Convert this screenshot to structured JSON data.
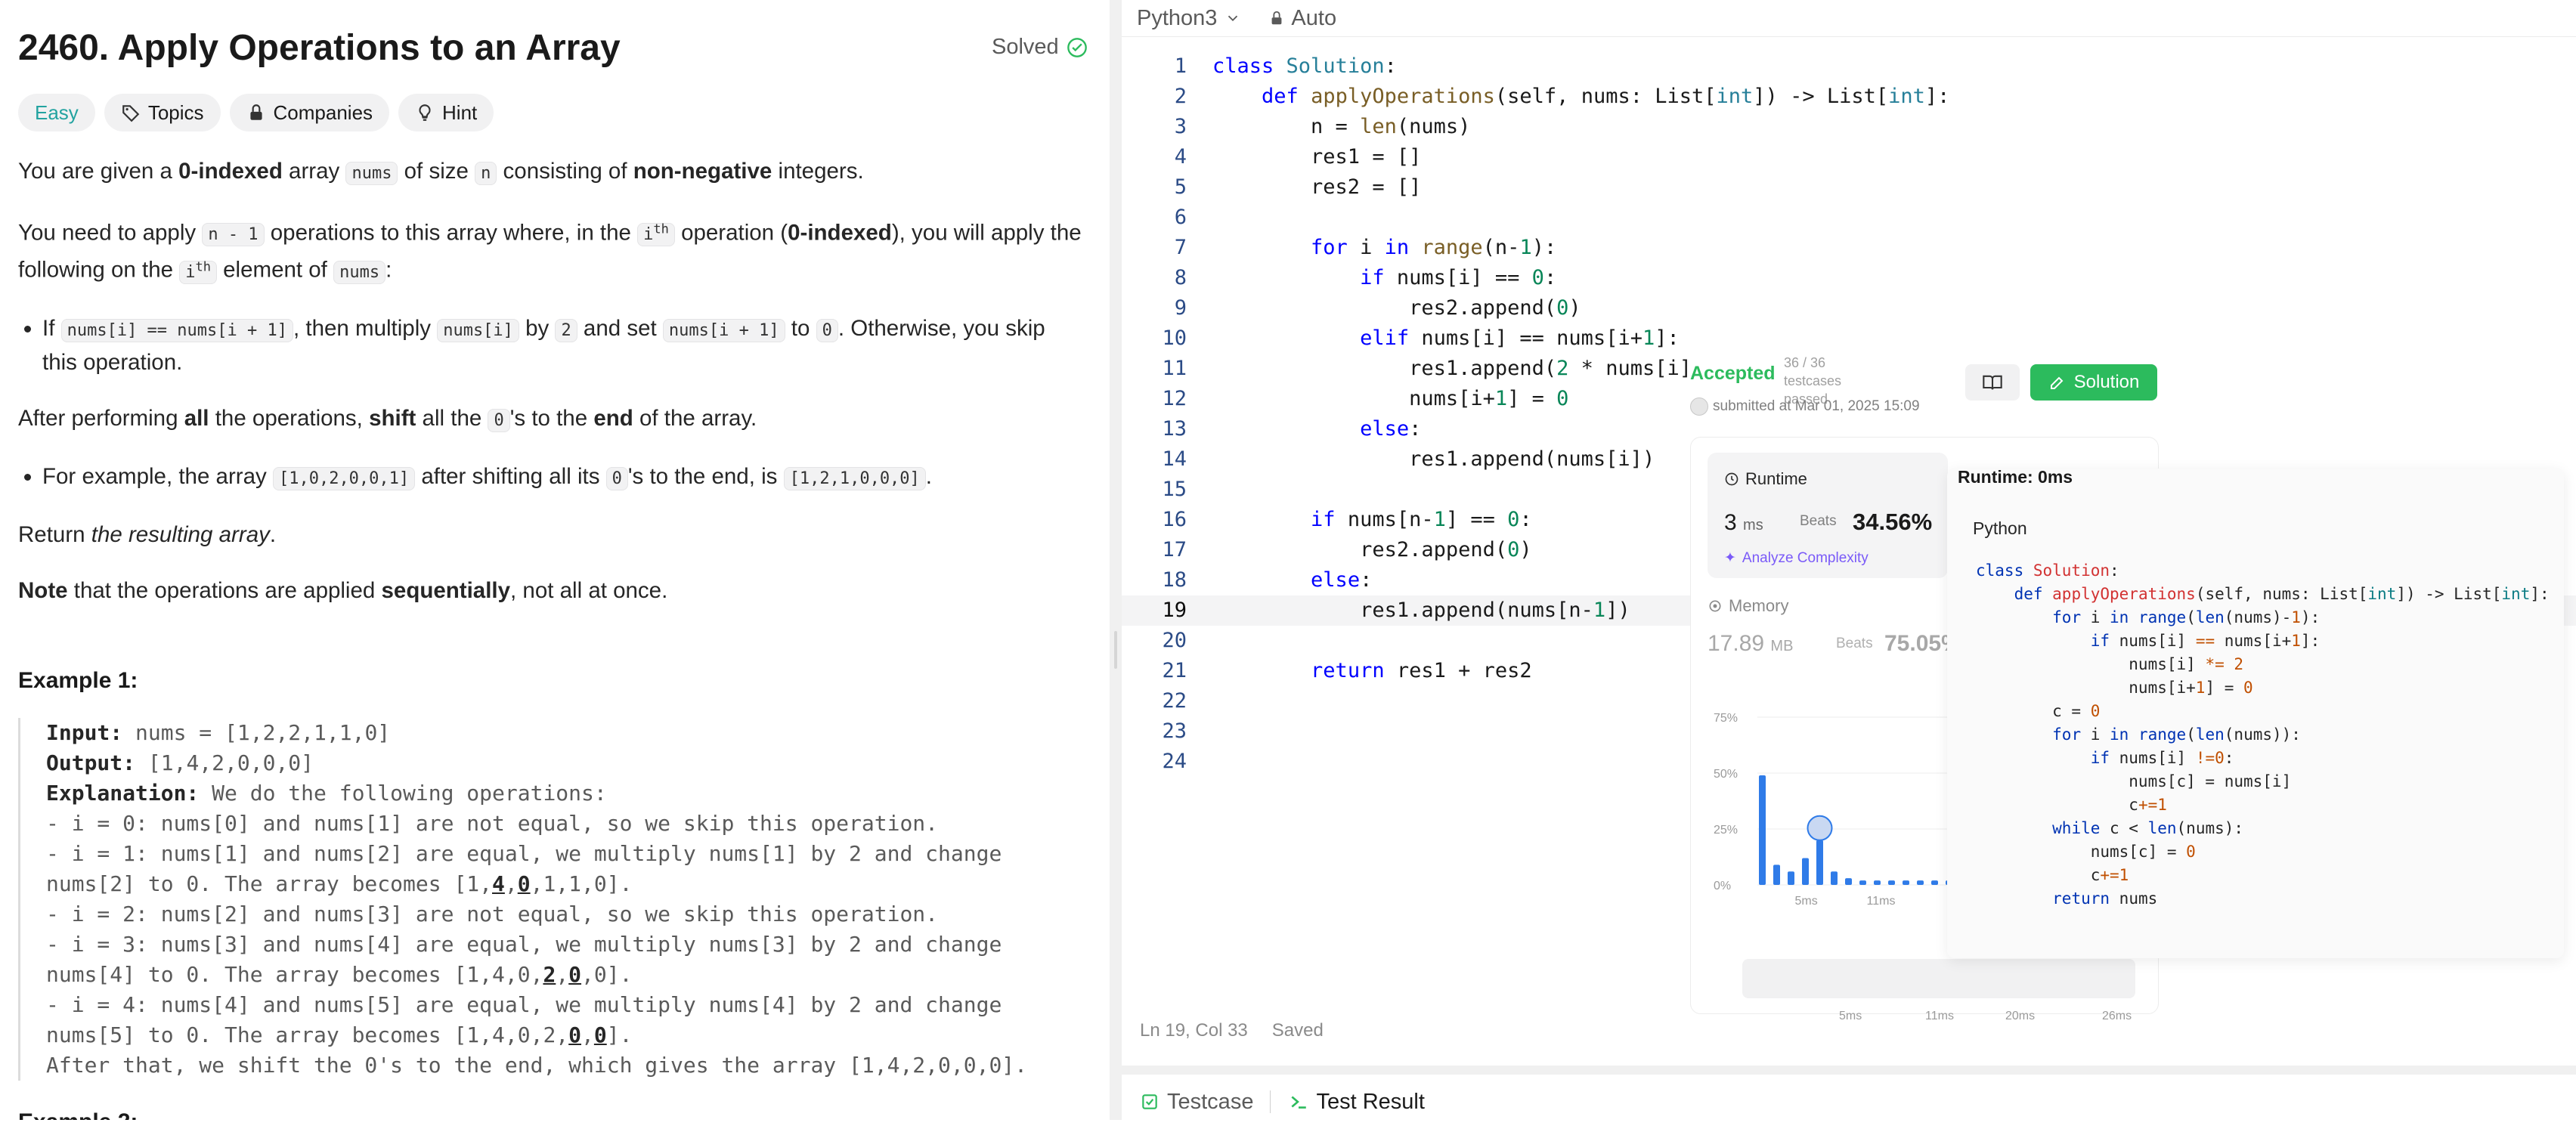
{
  "problem": {
    "title": "2460. Apply Operations to an Array",
    "status": "Solved",
    "tags": [
      "Easy",
      "Topics",
      "Companies",
      "Hint"
    ],
    "p1": {
      "t1": "You are given a ",
      "b1": "0-indexed",
      "t2": " array ",
      "c1": "nums",
      "t3": " of size ",
      "c2": "n",
      "t4": " consisting of ",
      "b2": "non-negative",
      "t5": " integers."
    },
    "p2": {
      "t1": "You need to apply ",
      "c1": "n - 1",
      "t2": " operations to this array where, in the ",
      "c2": "i",
      "s2": "th",
      "t3": " operation (",
      "b1": "0-indexed",
      "t4": "), you will apply the following on the ",
      "c3": "i",
      "s3": "th",
      "t5": " element of ",
      "c4": "nums",
      "t6": ":"
    },
    "b1": {
      "t1": "If ",
      "c1": "nums[i] == nums[i + 1]",
      "t2": ", then multiply ",
      "c2": "nums[i]",
      "t3": " by ",
      "c3": "2",
      "t4": " and set ",
      "c4": "nums[i + 1]",
      "t5": " to ",
      "c5": "0",
      "t6": ". Otherwise, you skip this operation."
    },
    "p3": {
      "t1": "After performing ",
      "b1": "all",
      "t2": " the operations, ",
      "b2": "shift",
      "t3": " all the ",
      "c1": "0",
      "t4": "'s to the ",
      "b3": "end",
      "t5": " of the array."
    },
    "b2": {
      "t1": "For example, the array ",
      "c1": "[1,0,2,0,0,1]",
      "t2": " after shifting all its ",
      "c2": "0",
      "t3": "'s to the end, is ",
      "c3": "[1,2,1,0,0,0]",
      "t4": "."
    },
    "p4": {
      "t1": "Return ",
      "i1": "the resulting array",
      "t2": "."
    },
    "p5": {
      "b1": "Note",
      "t1": " that the operations are applied ",
      "b2": "sequentially",
      "t2": ", not all at once."
    },
    "example1": {
      "title": "Example 1:",
      "input_label": "Input:",
      "input": " nums = [1,2,2,1,1,0]",
      "output_label": "Output:",
      "output": " [1,4,2,0,0,0]",
      "expl_label": "Explanation:",
      "expl": " We do the following operations:",
      "l1": "- i = 0: nums[0] and nums[1] are not equal, so we skip this operation.",
      "l2": "- i = 1: nums[1] and nums[2] are equal, we multiply nums[1] by 2 and change",
      "l3a": "nums[2] to 0. The array becomes [1,",
      "l3b1": "4",
      "l3c": ",",
      "l3b2": "0",
      "l3d": ",1,1,0].",
      "l4": "- i = 2: nums[2] and nums[3] are not equal, so we skip this operation.",
      "l5": "- i = 3: nums[3] and nums[4] are equal, we multiply nums[3] by 2 and change",
      "l6a": "nums[4] to 0. The array becomes [1,4,0,",
      "l6b1": "2",
      "l6c": ",",
      "l6b2": "0",
      "l6d": ",0].",
      "l7": "- i = 4: nums[4] and nums[5] are equal, we multiply nums[4] by 2 and change",
      "l8a": "nums[5] to 0. The array becomes [1,4,0,2,",
      "l8b1": "0",
      "l8c": ",",
      "l8b2": "0",
      "l8d": "].",
      "l9": "After that, we shift the 0's to the end, which gives the array [1,4,2,0,0,0]."
    },
    "example2_title": "Example 2:"
  },
  "editor": {
    "language": "Python3",
    "mode": "Auto",
    "lines": [
      [
        [
          "kw",
          "class "
        ],
        [
          "cls",
          "Solution"
        ],
        [
          "op",
          ":"
        ]
      ],
      [
        [
          "op",
          "    "
        ],
        [
          "kw",
          "def "
        ],
        [
          "fn",
          "applyOperations"
        ],
        [
          "op",
          "(self, nums: List["
        ],
        [
          "cls",
          "int"
        ],
        [
          "op",
          "]) -> List["
        ],
        [
          "cls",
          "int"
        ],
        [
          "op",
          "]:"
        ]
      ],
      [
        [
          "op",
          "        n = "
        ],
        [
          "fn",
          "len"
        ],
        [
          "op",
          "(nums)"
        ]
      ],
      [
        [
          "op",
          "        res1 = []"
        ]
      ],
      [
        [
          "op",
          "        res2 = []"
        ]
      ],
      [
        [
          "op",
          ""
        ]
      ],
      [
        [
          "op",
          "        "
        ],
        [
          "kw",
          "for "
        ],
        [
          "op",
          "i "
        ],
        [
          "kw",
          "in "
        ],
        [
          "fn",
          "range"
        ],
        [
          "op",
          "(n-"
        ],
        [
          "num",
          "1"
        ],
        [
          "op",
          "):"
        ]
      ],
      [
        [
          "op",
          "            "
        ],
        [
          "kw",
          "if "
        ],
        [
          "op",
          "nums[i] == "
        ],
        [
          "num",
          "0"
        ],
        [
          "op",
          ":"
        ]
      ],
      [
        [
          "op",
          "                res2.append("
        ],
        [
          "num",
          "0"
        ],
        [
          "op",
          ")"
        ]
      ],
      [
        [
          "op",
          "            "
        ],
        [
          "kw",
          "elif "
        ],
        [
          "op",
          "nums[i] == nums[i+"
        ],
        [
          "num",
          "1"
        ],
        [
          "op",
          "]:"
        ]
      ],
      [
        [
          "op",
          "                res1.append("
        ],
        [
          "num",
          "2"
        ],
        [
          "op",
          " * nums[i]"
        ]
      ],
      [
        [
          "op",
          "                nums[i+"
        ],
        [
          "num",
          "1"
        ],
        [
          "op",
          "] = "
        ],
        [
          "num",
          "0"
        ]
      ],
      [
        [
          "op",
          "            "
        ],
        [
          "kw",
          "else"
        ],
        [
          "op",
          ":"
        ]
      ],
      [
        [
          "op",
          "                res1.append(nums[i])"
        ]
      ],
      [
        [
          "op",
          ""
        ]
      ],
      [
        [
          "op",
          "        "
        ],
        [
          "kw",
          "if "
        ],
        [
          "op",
          "nums[n-"
        ],
        [
          "num",
          "1"
        ],
        [
          "op",
          "] == "
        ],
        [
          "num",
          "0"
        ],
        [
          "op",
          ":"
        ]
      ],
      [
        [
          "op",
          "            res2.append("
        ],
        [
          "num",
          "0"
        ],
        [
          "op",
          ")"
        ]
      ],
      [
        [
          "op",
          "        "
        ],
        [
          "kw",
          "else"
        ],
        [
          "op",
          ":"
        ]
      ],
      [
        [
          "op",
          "            res1.append(nums[n-"
        ],
        [
          "num",
          "1"
        ],
        [
          "op",
          "])"
        ]
      ],
      [
        [
          "op",
          ""
        ]
      ],
      [
        [
          "op",
          "        "
        ],
        [
          "kw",
          "return "
        ],
        [
          "op",
          "res1 + res2"
        ]
      ],
      [
        [
          "op",
          ""
        ]
      ],
      [
        [
          "op",
          ""
        ]
      ],
      [
        [
          "op",
          ""
        ]
      ]
    ],
    "status_position": "Ln 19, Col 33",
    "status_saved": "Saved",
    "current_line": 19
  },
  "bottom_tabs": [
    "Testcase",
    "Test Result"
  ],
  "submission": {
    "status": "Accepted",
    "testcases": "36 / 36 testcases passed",
    "submitted": "submitted at Mar 01, 2025 15:09",
    "solution_button": "Solution",
    "runtime_label": "Runtime",
    "runtime_value": "3",
    "runtime_unit": "ms",
    "beats_label": "Beats",
    "runtime_beats": "34.56%",
    "analyze": "Analyze Complexity",
    "memory_label": "Memory",
    "memory_value": "17.89",
    "memory_unit": "MB",
    "memory_beats": "75.05%"
  },
  "chart_data": {
    "type": "bar",
    "title": "",
    "ylabel": "",
    "y_ticks": [
      "75%",
      "50%",
      "25%",
      "0%"
    ],
    "x_ticks": [
      "5ms",
      "11ms"
    ],
    "ylim": [
      0,
      75
    ],
    "values": [
      49,
      9,
      6,
      12,
      20,
      6,
      3,
      2,
      2,
      2,
      2,
      2,
      2,
      2
    ],
    "highlight_index": 4,
    "minimap_ticks": [
      "5ms",
      "11ms",
      "20ms",
      "26ms"
    ]
  },
  "popup": {
    "title": "Runtime: 0ms",
    "language": "Python",
    "code": [
      [
        [
          "kw",
          "class "
        ],
        [
          "fn",
          "Solution"
        ],
        [
          "tx",
          ":"
        ]
      ],
      [
        [
          "tx",
          "    "
        ],
        [
          "kw",
          "def "
        ],
        [
          "fn",
          "applyOperations"
        ],
        [
          "tx",
          "(self, nums: List["
        ],
        [
          "tp",
          "int"
        ],
        [
          "tx",
          "]) -> List["
        ],
        [
          "tp",
          "int"
        ],
        [
          "tx",
          "]:"
        ]
      ],
      [
        [
          "tx",
          "        "
        ],
        [
          "kw",
          "for "
        ],
        [
          "tx",
          "i "
        ],
        [
          "kw",
          "in "
        ],
        [
          "kw",
          "range"
        ],
        [
          "tx",
          "("
        ],
        [
          "kw",
          "len"
        ],
        [
          "tx",
          "(nums)-"
        ],
        [
          "nm",
          "1"
        ],
        [
          "tx",
          "):"
        ]
      ],
      [
        [
          "tx",
          "            "
        ],
        [
          "kw",
          "if "
        ],
        [
          "tx",
          "nums[i] "
        ],
        [
          "op",
          "=="
        ],
        [
          "tx",
          " nums[i+"
        ],
        [
          "nm",
          "1"
        ],
        [
          "tx",
          "]:"
        ]
      ],
      [
        [
          "tx",
          "                nums[i] "
        ],
        [
          "op",
          "*="
        ],
        [
          "tx",
          " "
        ],
        [
          "nm",
          "2"
        ]
      ],
      [
        [
          "tx",
          "                nums[i+"
        ],
        [
          "nm",
          "1"
        ],
        [
          "tx",
          "] = "
        ],
        [
          "nm",
          "0"
        ]
      ],
      [
        [
          "tx",
          "        c = "
        ],
        [
          "nm",
          "0"
        ]
      ],
      [
        [
          "tx",
          "        "
        ],
        [
          "kw",
          "for "
        ],
        [
          "tx",
          "i "
        ],
        [
          "kw",
          "in "
        ],
        [
          "kw",
          "range"
        ],
        [
          "tx",
          "("
        ],
        [
          "kw",
          "len"
        ],
        [
          "tx",
          "(nums)):"
        ]
      ],
      [
        [
          "tx",
          "            "
        ],
        [
          "kw",
          "if "
        ],
        [
          "tx",
          "nums[i] "
        ],
        [
          "op",
          "!="
        ],
        [
          "nm",
          "0"
        ],
        [
          "tx",
          ":"
        ]
      ],
      [
        [
          "tx",
          "                nums[c] = nums[i]"
        ]
      ],
      [
        [
          "tx",
          "                c"
        ],
        [
          "op",
          "+="
        ],
        [
          "nm",
          "1"
        ]
      ],
      [
        [
          "tx",
          "        "
        ],
        [
          "kw",
          "while "
        ],
        [
          "tx",
          "c < "
        ],
        [
          "kw",
          "len"
        ],
        [
          "tx",
          "(nums):"
        ]
      ],
      [
        [
          "tx",
          "            nums[c] = "
        ],
        [
          "nm",
          "0"
        ]
      ],
      [
        [
          "tx",
          "            c"
        ],
        [
          "op",
          "+="
        ],
        [
          "nm",
          "1"
        ]
      ],
      [
        [
          "tx",
          "        "
        ],
        [
          "kw",
          "return "
        ],
        [
          "tx",
          "nums"
        ]
      ]
    ]
  }
}
